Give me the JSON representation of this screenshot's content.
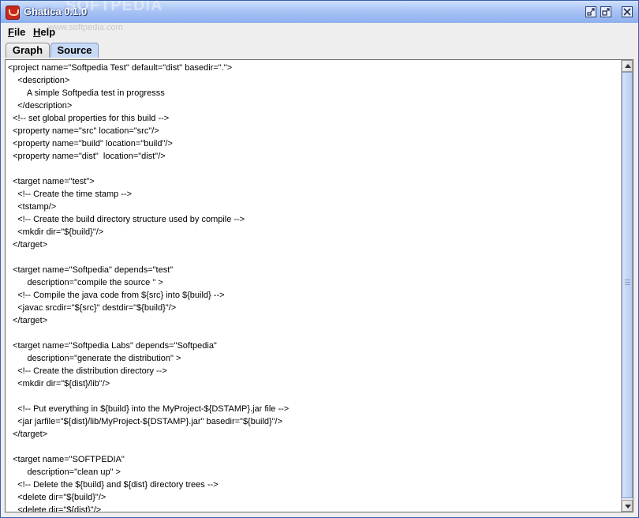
{
  "window": {
    "title": "Ghatica 0.1.0",
    "watermark_text": "SOFTPEDIA"
  },
  "titlebar_icons": [
    "minimize-icon",
    "maximize-icon",
    "close-icon"
  ],
  "menu": {
    "file": {
      "mnemonic": "F",
      "rest": "ile"
    },
    "help": {
      "mnemonic": "H",
      "rest": "elp"
    },
    "watermark_url": "www.softpedia.com"
  },
  "tabs": [
    {
      "label": "Graph",
      "selected": false
    },
    {
      "label": "Source",
      "selected": true
    }
  ],
  "editor": {
    "lines": [
      "<project name=\"Softpedia Test\" default=\"dist\" basedir=\".\">",
      "    <description>",
      "        A simple Softpedia test in progresss",
      "    </description>",
      "  <!-- set global properties for this build -->",
      "  <property name=\"src\" location=\"src\"/>",
      "  <property name=\"build\" location=\"build\"/>",
      "  <property name=\"dist\"  location=\"dist\"/>",
      "",
      "  <target name=\"test\">",
      "    <!-- Create the time stamp -->",
      "    <tstamp/>",
      "    <!-- Create the build directory structure used by compile -->",
      "    <mkdir dir=\"${build}\"/>",
      "  </target>",
      "",
      "  <target name=\"Softpedia\" depends=\"test\"",
      "        description=\"compile the source \" >",
      "    <!-- Compile the java code from ${src} into ${build} -->",
      "    <javac srcdir=\"${src}\" destdir=\"${build}\"/>",
      "  </target>",
      "",
      "  <target name=\"Softpedia Labs\" depends=\"Softpedia\"",
      "        description=\"generate the distribution\" >",
      "    <!-- Create the distribution directory -->",
      "    <mkdir dir=\"${dist}/lib\"/>",
      "",
      "    <!-- Put everything in ${build} into the MyProject-${DSTAMP}.jar file -->",
      "    <jar jarfile=\"${dist}/lib/MyProject-${DSTAMP}.jar\" basedir=\"${build}\"/>",
      "  </target>",
      "",
      "  <target name=\"SOFTPEDIA\"",
      "        description=\"clean up\" >",
      "    <!-- Delete the ${build} and ${dist} directory trees -->",
      "    <delete dir=\"${build}\"/>",
      "    <delete dir=\"${dist}\"/>"
    ]
  },
  "colors": {
    "titlebar": "#a9c4f5",
    "selected_tab": "#c9daf4",
    "scroll_thumb": "#b7cbee"
  }
}
